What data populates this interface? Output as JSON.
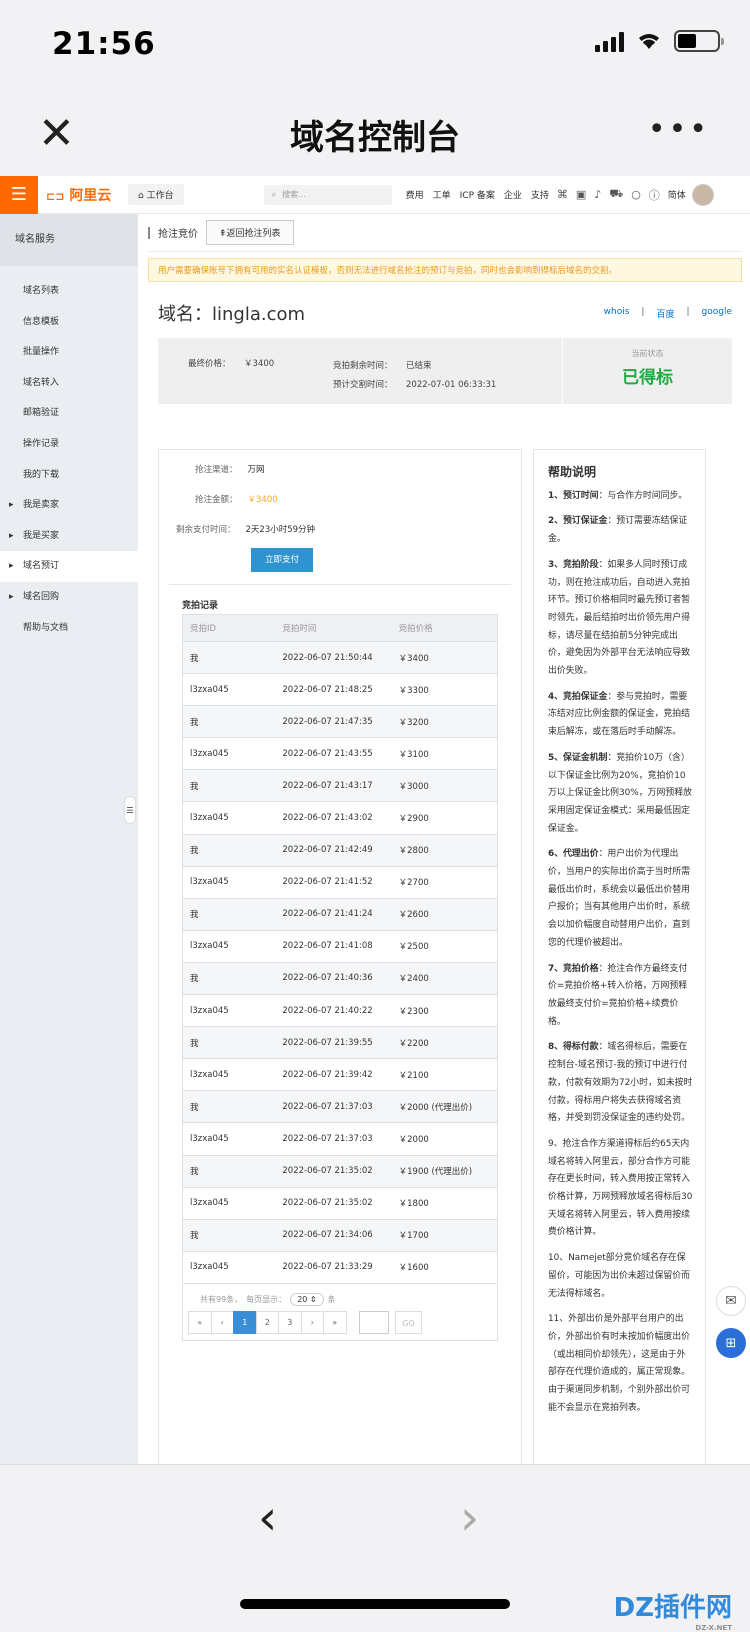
{
  "status_bar": {
    "time": "21:56"
  },
  "nav": {
    "title": "域名控制台",
    "more": "•••"
  },
  "topbar": {
    "logo": "阿里云",
    "workbench": "工作台",
    "search_placeholder": "搜索...",
    "links": [
      "费用",
      "工单",
      "ICP 备案",
      "企业",
      "支持"
    ],
    "lang": "简体"
  },
  "sidebar": {
    "header": "域名服务",
    "items": [
      {
        "label": "域名列表"
      },
      {
        "label": "信息模板"
      },
      {
        "label": "批量操作"
      },
      {
        "label": "域名转入"
      },
      {
        "label": "邮箱验证"
      },
      {
        "label": "操作记录"
      },
      {
        "label": "我的下载"
      },
      {
        "label": "我是卖家"
      },
      {
        "label": "我是买家"
      },
      {
        "label": "域名预订"
      },
      {
        "label": "域名回购"
      },
      {
        "label": "帮助与文档"
      }
    ]
  },
  "crumb": {
    "title": "抢注竞价",
    "back": "返回抢注列表"
  },
  "notice": "用户需要确保账号下拥有可用的实名认证模板，否则无法进行域名抢注的预订与竞拍，同时也会影响到得标后域名的交割。",
  "domain": {
    "label": "域名：",
    "name": "lingla.com",
    "links": [
      "whois",
      "百度",
      "google"
    ],
    "sep": "|"
  },
  "summary": {
    "final_price_label": "最终价格：",
    "final_price": "￥3400",
    "remaining_label": "竞拍剩余时间：",
    "remaining": "已结束",
    "settle_label": "预计交割时间：",
    "settle": "2022-07-01 06:33:31",
    "state_label": "当前状态",
    "state": "已得标"
  },
  "order": {
    "channel_label": "抢注渠道：",
    "channel": "万网",
    "amount_label": "抢注金额：",
    "amount": "￥3400",
    "remain_pay_label": "剩余支付时间：",
    "remain_pay": "2天23小时59分钟",
    "pay_button": "立即支付"
  },
  "records": {
    "title": "竞拍记录",
    "headers": [
      "竞拍ID",
      "竞拍时间",
      "竞拍价格"
    ],
    "rows": [
      [
        "我",
        "2022-06-07 21:50:44",
        "￥3400"
      ],
      [
        "l3zxa045",
        "2022-06-07 21:48:25",
        "￥3300"
      ],
      [
        "我",
        "2022-06-07 21:47:35",
        "￥3200"
      ],
      [
        "l3zxa045",
        "2022-06-07 21:43:55",
        "￥3100"
      ],
      [
        "我",
        "2022-06-07 21:43:17",
        "￥3000"
      ],
      [
        "l3zxa045",
        "2022-06-07 21:43:02",
        "￥2900"
      ],
      [
        "我",
        "2022-06-07 21:42:49",
        "￥2800"
      ],
      [
        "l3zxa045",
        "2022-06-07 21:41:52",
        "￥2700"
      ],
      [
        "我",
        "2022-06-07 21:41:24",
        "￥2600"
      ],
      [
        "l3zxa045",
        "2022-06-07 21:41:08",
        "￥2500"
      ],
      [
        "我",
        "2022-06-07 21:40:36",
        "￥2400"
      ],
      [
        "l3zxa045",
        "2022-06-07 21:40:22",
        "￥2300"
      ],
      [
        "我",
        "2022-06-07 21:39:55",
        "￥2200"
      ],
      [
        "l3zxa045",
        "2022-06-07 21:39:42",
        "￥2100"
      ],
      [
        "我",
        "2022-06-07 21:37:03",
        "￥2000 (代理出价)"
      ],
      [
        "l3zxa045",
        "2022-06-07 21:37:03",
        "￥2000"
      ],
      [
        "我",
        "2022-06-07 21:35:02",
        "￥1900 (代理出价)"
      ],
      [
        "l3zxa045",
        "2022-06-07 21:35:02",
        "￥1800"
      ],
      [
        "我",
        "2022-06-07 21:34:06",
        "￥1700"
      ],
      [
        "l3zxa045",
        "2022-06-07 21:33:29",
        "￥1600"
      ]
    ],
    "pager": {
      "total": "共有99条，",
      "per_page_label": "每页显示：",
      "per_page": "20",
      "unit": "条",
      "buttons": [
        "«",
        "‹",
        "1",
        "2",
        "3",
        "›",
        "»"
      ],
      "go": "GO"
    }
  },
  "help": {
    "title": "帮助说明",
    "items": [
      {
        "head": "1、预订时间",
        "text": "：与合作方时间同步。"
      },
      {
        "head": "2、预订保证金",
        "text": "：预订需要冻结保证金。"
      },
      {
        "head": "3、竞拍阶段",
        "text": "：如果多人同时预订成功，则在抢注成功后，自动进入竞拍环节。预订价格相同时最先预订者暂时领先，最后结拍时出价领先用户得标，请尽量在结拍前5分钟完成出价，避免因为外部平台无法响应导致出价失败。"
      },
      {
        "head": "4、竞拍保证金",
        "text": "：参与竞拍时，需要冻结对应比例金额的保证金，竞拍结束后解冻，或在落后时手动解冻。"
      },
      {
        "head": "5、保证金机制",
        "text": "：竞拍价10万（含）以下保证金比例为20%，竞拍价10万以上保证金比例30%，万网预释放采用固定保证金模式：采用最低固定保证金。"
      },
      {
        "head": "6、代理出价",
        "text": "：用户出价为代理出价，当用户的实际出价高于当时所需最低出价时，系统会以最低出价替用户报价；当有其他用户出价时，系统会以加价幅度自动替用户出价，直到您的代理价被超出。"
      },
      {
        "head": "7、竞拍价格",
        "text": "：抢注合作方最终支付价=竞拍价格+转入价格，万网预释放最终支付价=竞拍价格+续费价格。"
      },
      {
        "head": "8、得标付款",
        "text": "：域名得标后，需要在控制台-域名预订-我的预订中进行付款，付款有效期为72小时，如未按时付款，得标用户将失去获得域名资格，并受到罚没保证金的违约处罚。"
      },
      {
        "head": "",
        "text": "9、抢注合作方渠道得标后约65天内域名将转入阿里云，部分合作方可能存在更长时间，转入费用按正常转入价格计算，万网预释放域名得标后30天域名将转入阿里云，转入费用按续费价格计算。"
      },
      {
        "head": "",
        "text": "10、Namejet部分竞价域名存在保留价，可能因为出价未超过保留价而无法得标域名。"
      },
      {
        "head": "",
        "text": "11、外部出价是外部平台用户的出价，外部出价有时未按加价幅度出价（或出相同价却领先），这是由于外部存在代理价造成的，属正常现象。由于渠道同步机制，个别外部出价可能不会显示在竞拍列表。"
      }
    ]
  },
  "watermark": {
    "brand": "DZ插件网",
    "sub": "DZ-X.NET"
  }
}
